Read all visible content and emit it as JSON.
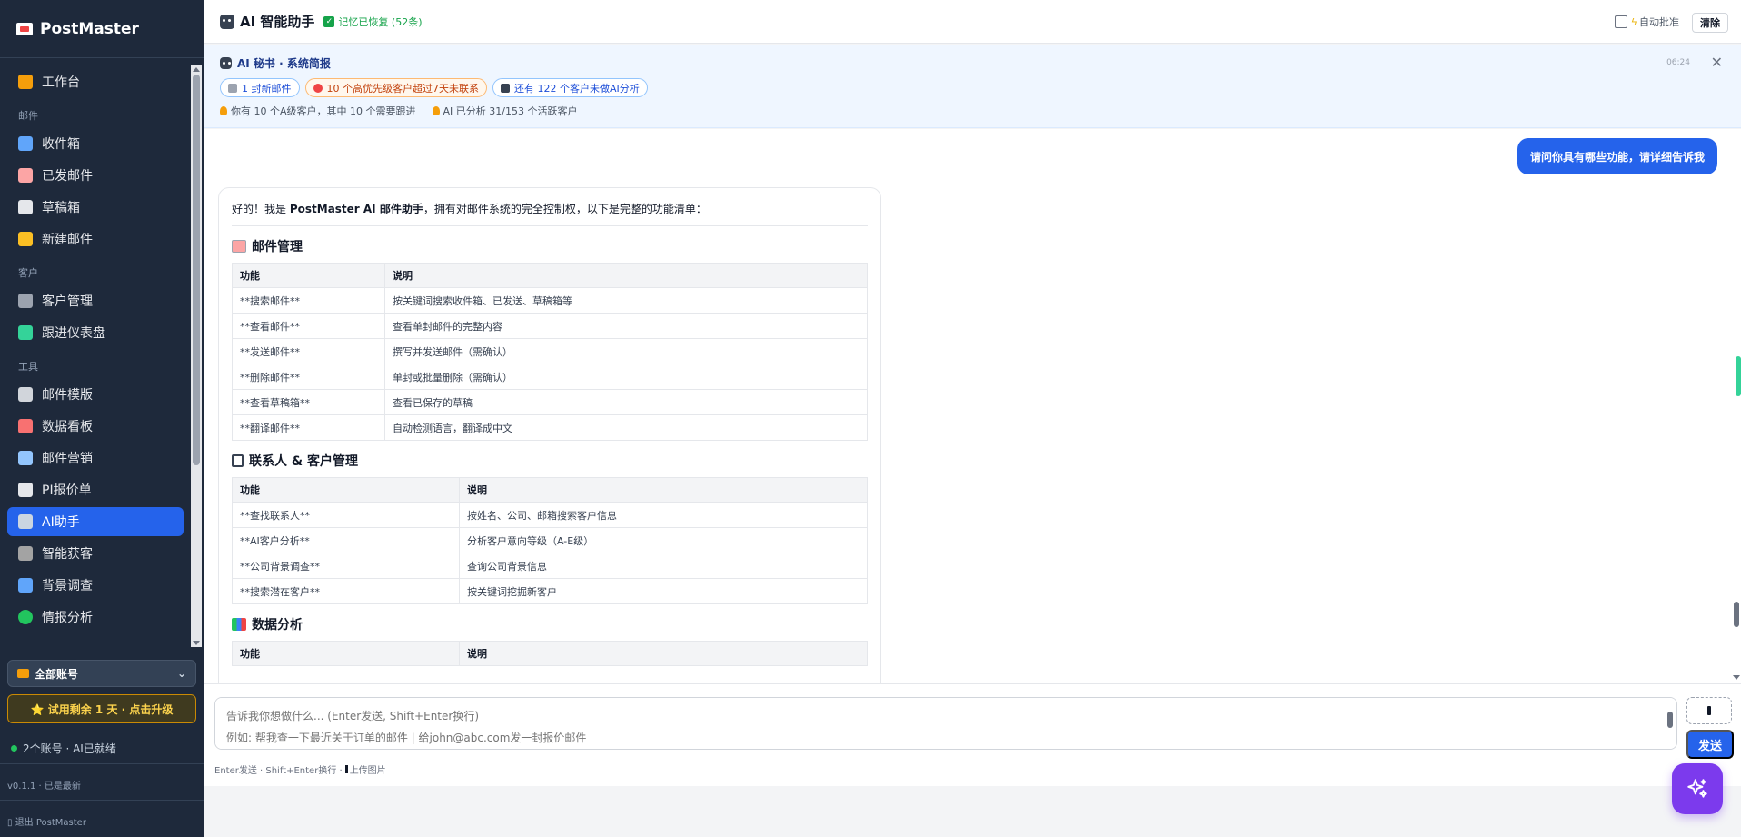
{
  "app": {
    "name": "PostMaster"
  },
  "sidebar": {
    "workbench": "工作台",
    "sections": {
      "mail": "邮件",
      "customer": "客户",
      "tools": "工具"
    },
    "mail_items": [
      "收件箱",
      "已发邮件",
      "草稿箱",
      "新建邮件"
    ],
    "customer_items": [
      "客户管理",
      "跟进仪表盘"
    ],
    "tool_items": [
      "邮件模版",
      "数据看板",
      "邮件营销",
      "PI报价单",
      "AI助手",
      "智能获客",
      "背景调查",
      "情报分析"
    ],
    "account_select": "全部账号",
    "trial": "⭐ 试用剩余 1 天 · 点击升级",
    "status": "2个账号 · AI已就绪",
    "version": "v0.1.1 · 已是最新",
    "logout": "退出 PostMaster"
  },
  "header": {
    "title": "AI 智能助手",
    "memory": "记忆已恢复 (52条)",
    "auto_approve": "自动批准",
    "clear": "清除"
  },
  "briefing": {
    "title": "AI 秘书 · 系统简报",
    "time": "06:24",
    "chips": [
      "1 封新邮件",
      "10 个高优先级客户超过7天未联系",
      "还有 122 个客户未做AI分析"
    ],
    "notes": [
      "你有 10 个A级客户，其中 10 个需要跟进",
      "AI 已分析 31/153 个活跃客户"
    ]
  },
  "chat": {
    "user_message": "请问你具有哪些功能，请详细告诉我",
    "ai_intro_prefix": "好的！我是 ",
    "ai_intro_bold": "PostMaster AI 邮件助手",
    "ai_intro_suffix": "，拥有对邮件系统的完全控制权，以下是完整的功能清单：",
    "col_func": "功能",
    "col_desc": "说明",
    "sections": [
      {
        "title": "邮件管理",
        "rows": [
          [
            "**搜索邮件**",
            "按关键词搜索收件箱、已发送、草稿箱等"
          ],
          [
            "**查看邮件**",
            "查看单封邮件的完整内容"
          ],
          [
            "**发送邮件**",
            "撰写并发送邮件（需确认）"
          ],
          [
            "**删除邮件**",
            "单封或批量删除（需确认）"
          ],
          [
            "**查看草稿箱**",
            "查看已保存的草稿"
          ],
          [
            "**翻译邮件**",
            "自动检测语言，翻译成中文"
          ]
        ]
      },
      {
        "title": "联系人 & 客户管理",
        "rows": [
          [
            "**查找联系人**",
            "按姓名、公司、邮箱搜索客户信息"
          ],
          [
            "**AI客户分析**",
            "分析客户意向等级（A-E级）"
          ],
          [
            "**公司背景调查**",
            "查询公司背景信息"
          ],
          [
            "**搜索潜在客户**",
            "按关键词挖掘新客户"
          ]
        ]
      },
      {
        "title": "数据分析",
        "rows": []
      }
    ]
  },
  "input": {
    "placeholder": "告诉我你想做什么... (Enter发送, Shift+Enter换行)\n例如: 帮我查一下最近关于订单的邮件 | 给john@abc.com发一封报价邮件",
    "send": "发送",
    "hint": "Enter发送 · Shift+Enter换行 ·",
    "hint_upload": "上传图片"
  },
  "colors": {
    "accent": "#2563eb",
    "sidebar_bg": "#1e293b",
    "fab": "#7c3aed"
  }
}
